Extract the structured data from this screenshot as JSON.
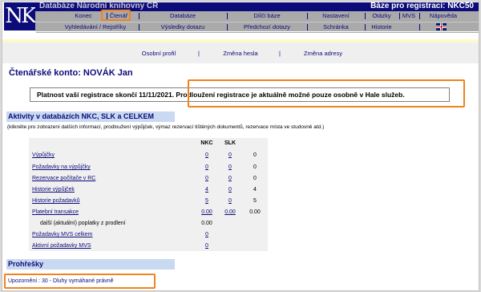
{
  "header": {
    "library_title": "Databáze Národní knihovny ČR",
    "base_label": "Báze pro registraci:  NKC50",
    "logo_text": "NK"
  },
  "menu_row1": [
    "Konec",
    "Čtenář",
    "Databáze",
    "Dílčí báze",
    "Nastavení",
    "Otázky",
    "MVS",
    "Nápověda"
  ],
  "menu_row2": [
    "Vyhledávání / Rejstříky",
    "Výsledky dotazu",
    "Předchozí dotazy",
    "Schránka",
    "Historie"
  ],
  "subnav": [
    "Osobní profil",
    "Změna hesla",
    "Změna adresy"
  ],
  "account": {
    "title": "Čtenářské konto:  NOVÁK Jan",
    "notice": "Platnost vaší registrace skončí 11/11/2021. Prodloužení registrace je aktuálně možné pouze osobně v Hale služeb."
  },
  "activities": {
    "title": "Aktivity v databázích NKC, SLK a CELKEM",
    "description": "(klikněte pro zobrazení dalších informací, prodloužení výpůjček, výmaz rezervací tištěných dokumentů, rezervace místa ve studovně atd.)",
    "columns": [
      "NKC",
      "SLK"
    ],
    "rows": [
      {
        "label": "Výpůjčky",
        "nkc": "0",
        "slk": "0",
        "total": "0"
      },
      {
        "label": "Požadavky na výpůjčky",
        "nkc": "0",
        "slk": "0",
        "total": "0"
      },
      {
        "label": "Rezervace počítače v RC",
        "nkc": "0",
        "slk": "0",
        "total": "0"
      },
      {
        "label": "Historie výpůjček",
        "nkc": "4",
        "slk": "0",
        "total": "4"
      },
      {
        "label": "Historie požadavků",
        "nkc": "5",
        "slk": "0",
        "total": "5"
      },
      {
        "label": "Platební transakce",
        "nkc": "0.00",
        "slk": "0.00",
        "total": "0.00"
      },
      {
        "label": "další (aktuální) poplatky z prodlení",
        "nkc": "0.00",
        "slk": "",
        "total": ""
      },
      {
        "label": "Požadavky MVS celkem",
        "nkc": "0",
        "slk": "",
        "total": ""
      },
      {
        "label": "Aktivní požadavky MVS",
        "nkc": "0",
        "slk": "",
        "total": ""
      }
    ]
  },
  "violations": {
    "title": "Prohřešky",
    "warning": "Upozornění : 30 - Dluhy vymáhané právně"
  },
  "colors": {
    "navy": "#0b0b7a",
    "menu_gray": "#aaaaaa",
    "highlight": "#f0831d",
    "section_bg": "#c9d9f1"
  },
  "icons": {
    "flag": "uk-flag-icon"
  }
}
